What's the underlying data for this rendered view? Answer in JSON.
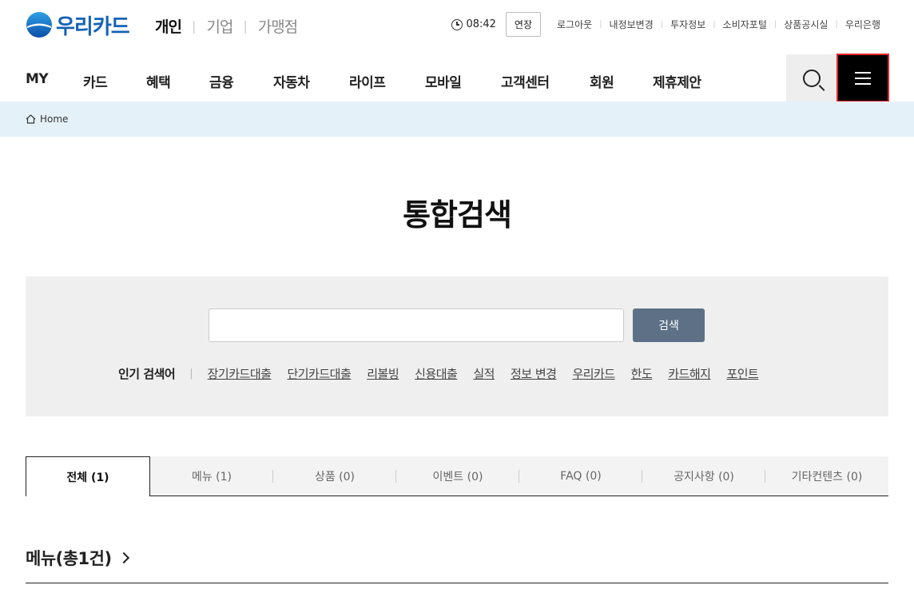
{
  "brand": {
    "name": "우리카드",
    "color": "#1462b7"
  },
  "site_tabs": [
    {
      "label": "개인",
      "active": true
    },
    {
      "label": "기업",
      "active": false
    },
    {
      "label": "가맹점",
      "active": false
    }
  ],
  "util": {
    "session_time": "08:42",
    "extend_label": "연장",
    "links": [
      "로그아웃",
      "내정보변경",
      "투자정보",
      "소비자포털",
      "상품공시실",
      "우리은행"
    ]
  },
  "gnb": [
    "MY",
    "카드",
    "혜택",
    "금융",
    "자동차",
    "라이프",
    "모바일",
    "고객센터",
    "회원",
    "제휴제안"
  ],
  "breadcrumb": {
    "home": "Home"
  },
  "page_title": "통합검색",
  "search": {
    "value": "",
    "placeholder": "",
    "button_label": "검색",
    "popular_label": "인기 검색어",
    "popular_keywords": [
      "장기카드대출",
      "단기카드대출",
      "리볼빙",
      "신용대출",
      "실적",
      "정보 변경",
      "우리카드",
      "한도",
      "카드해지",
      "포인트"
    ]
  },
  "tabs": [
    {
      "label": "전체 (1)",
      "active": true
    },
    {
      "label": "메뉴 (1)",
      "active": false
    },
    {
      "label": "상품 (0)",
      "active": false
    },
    {
      "label": "이벤트 (0)",
      "active": false
    },
    {
      "label": "FAQ (0)",
      "active": false
    },
    {
      "label": "공지사항 (0)",
      "active": false
    },
    {
      "label": "기타컨텐츠 (0)",
      "active": false
    }
  ],
  "results": {
    "menu_heading": "메뉴(총1건)"
  },
  "colors": {
    "search_button": "#5d7085",
    "breadcrumb_bg": "#e5f1f8",
    "panel_bg": "#efefef",
    "menu_button_bg": "#000000"
  }
}
